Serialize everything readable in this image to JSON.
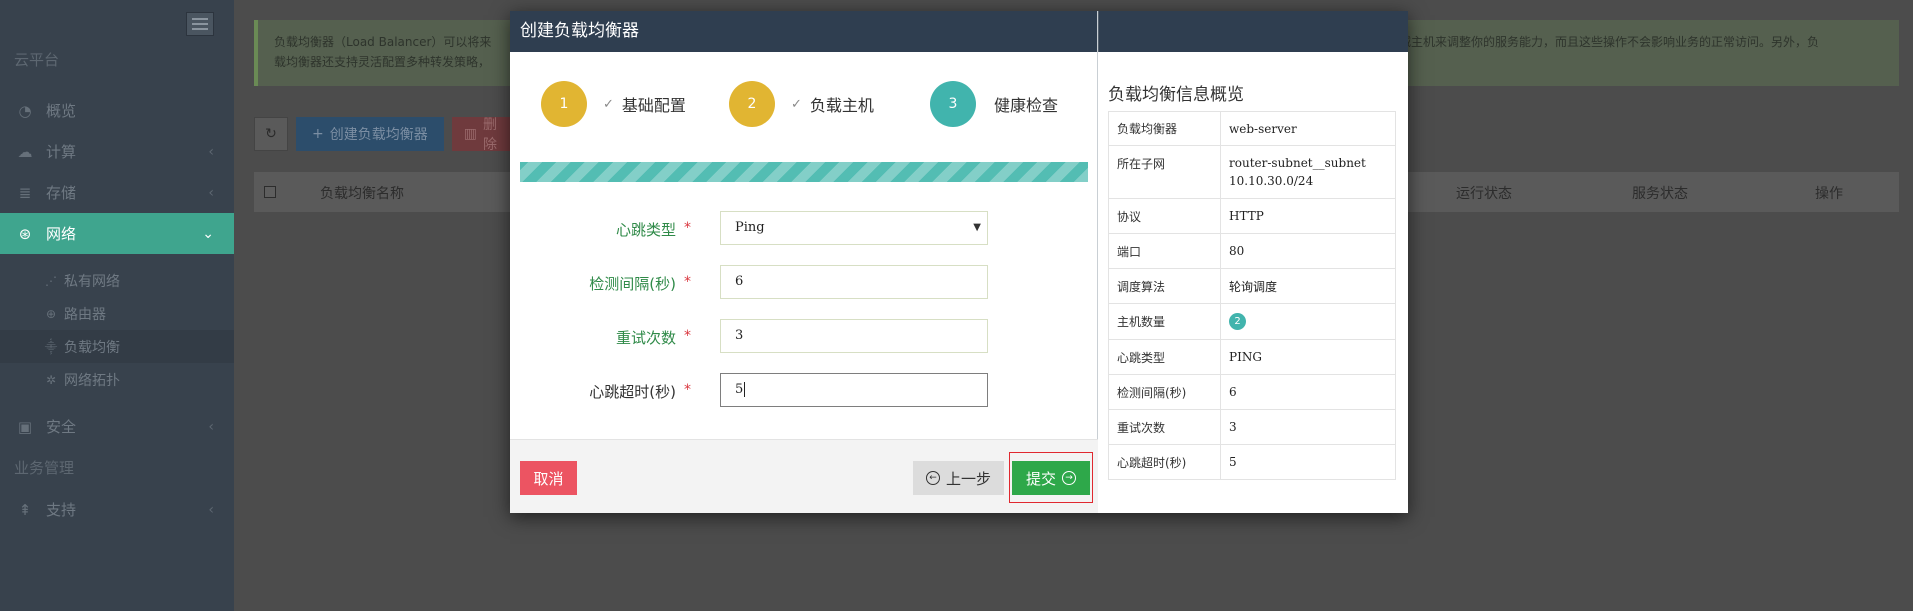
{
  "sidebar": {
    "platform_label": "云平台",
    "items": [
      {
        "label": "概览",
        "icon": "dashboard-icon"
      },
      {
        "label": "计算",
        "icon": "cloud-icon"
      },
      {
        "label": "存储",
        "icon": "database-icon"
      },
      {
        "label": "网络",
        "icon": "network-icon"
      }
    ],
    "subitems": [
      {
        "label": "私有网络",
        "icon": "rss-icon"
      },
      {
        "label": "路由器",
        "icon": "router-icon"
      },
      {
        "label": "负载均衡",
        "icon": "sitemap-icon"
      },
      {
        "label": "网络拓扑",
        "icon": "topology-icon"
      }
    ],
    "security_label": "安全",
    "business_label": "业务管理",
    "support_label": "支持"
  },
  "main": {
    "notice_left_line1": "负载均衡器（Load Balancer）可以将来",
    "notice_left_line2": "载均衡器还支持灵活配置多种转发策略，",
    "notice_right_line1": "减主机来调整你的服务能力，而且这些操作不会影响业务的正常访问。另外，负",
    "create_button": "创建负载均衡器",
    "delete_button": "删除",
    "columns": {
      "name": "负载均衡名称",
      "run_state": "运行状态",
      "service_state": "服务状态",
      "ops": "操作"
    }
  },
  "modal": {
    "title": "创建负载均衡器",
    "steps": [
      {
        "number": "1",
        "label": "基础配置",
        "done": true
      },
      {
        "number": "2",
        "label": "负载主机",
        "done": true
      },
      {
        "number": "3",
        "label": "健康检查",
        "done": false
      }
    ],
    "progress_percent": 100,
    "form": {
      "heartbeat_type_label": "心跳类型",
      "heartbeat_type_value": "Ping",
      "check_interval_label": "检测间隔(秒)",
      "check_interval_value": "6",
      "retry_label": "重试次数",
      "retry_value": "3",
      "timeout_label": "心跳超时(秒)",
      "timeout_value": "5",
      "required_mark": "*"
    },
    "buttons": {
      "cancel": "取消",
      "prev": "上一步",
      "submit": "提交"
    },
    "summary": {
      "title": "负载均衡信息概览",
      "rows": [
        {
          "key": "负载均衡器",
          "value": "web-server"
        },
        {
          "key": "所在子网",
          "value": "router-subnet__subnet",
          "value2": "10.10.30.0/24"
        },
        {
          "key": "协议",
          "value": "HTTP"
        },
        {
          "key": "端口",
          "value": "80"
        },
        {
          "key": "调度算法",
          "value": "轮询调度"
        },
        {
          "key": "主机数量",
          "value": "2"
        },
        {
          "key": "心跳类型",
          "value": "PING"
        },
        {
          "key": "检测间隔(秒)",
          "value": "6"
        },
        {
          "key": "重试次数",
          "value": "3"
        },
        {
          "key": "心跳超时(秒)",
          "value": "5"
        }
      ]
    }
  },
  "colors": {
    "accent_teal": "#3fa58e",
    "header_navy": "#2f3e50",
    "step_done": "#e1b532",
    "step_current": "#41b4ad",
    "submit_green": "#2ea84a",
    "cancel_red": "#ec5462"
  }
}
